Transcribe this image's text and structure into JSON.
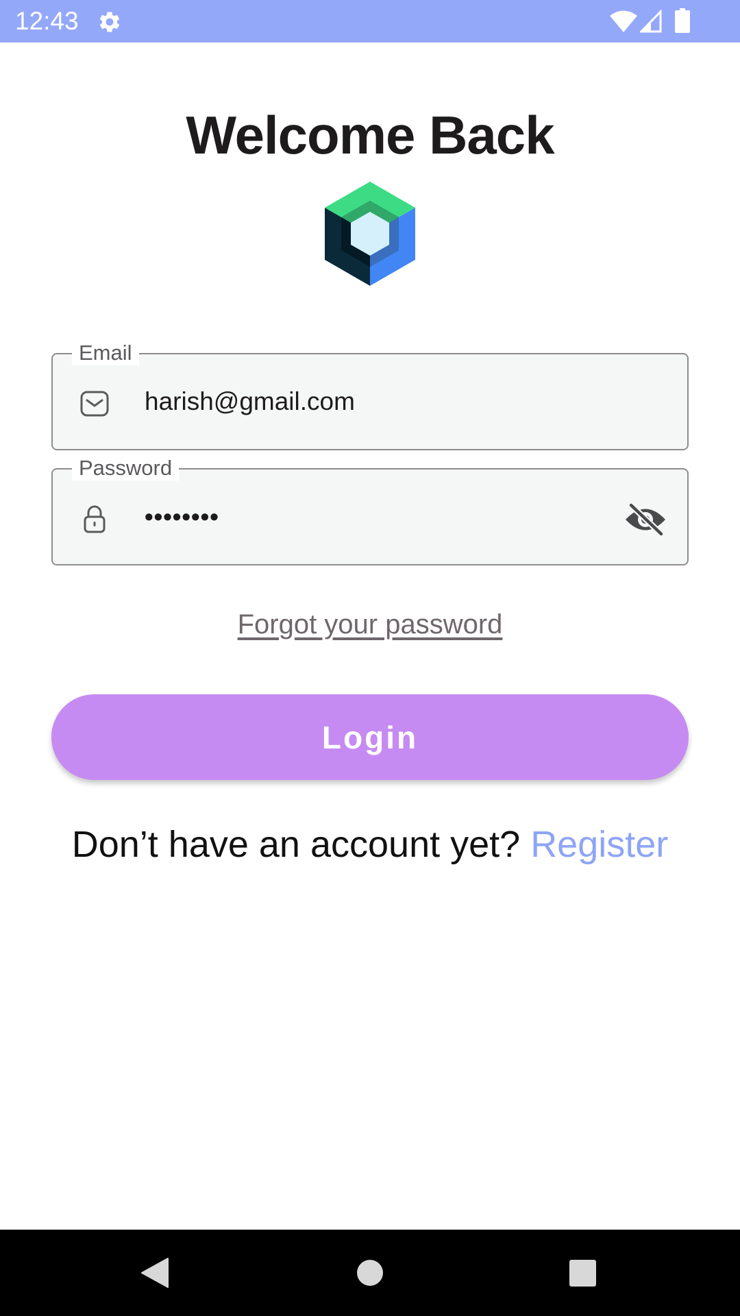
{
  "status_bar": {
    "time": "12:43",
    "background_color": "#94A8FA",
    "icons": [
      "gear-icon",
      "wifi-icon",
      "signal-icon",
      "battery-icon"
    ]
  },
  "header": {
    "title": "Welcome Back",
    "logo_icon": "jetpack-compose-logo"
  },
  "form": {
    "email": {
      "label": "Email",
      "value": "harish@gmail.com",
      "icon": "mail-icon"
    },
    "password": {
      "label": "Password",
      "value": "••••••••",
      "icon": "lock-icon",
      "visibility_icon": "visibility-off-icon"
    },
    "forgot_password": "Forgot your password",
    "login_button": {
      "label": "Login",
      "color": "#C68BF2"
    },
    "register_prompt": "Don’t have an account yet?",
    "register_link": "Register",
    "link_color": "#8EA4F5"
  },
  "nav_bar": {
    "icons": [
      "back-icon",
      "home-icon",
      "recents-icon"
    ]
  }
}
